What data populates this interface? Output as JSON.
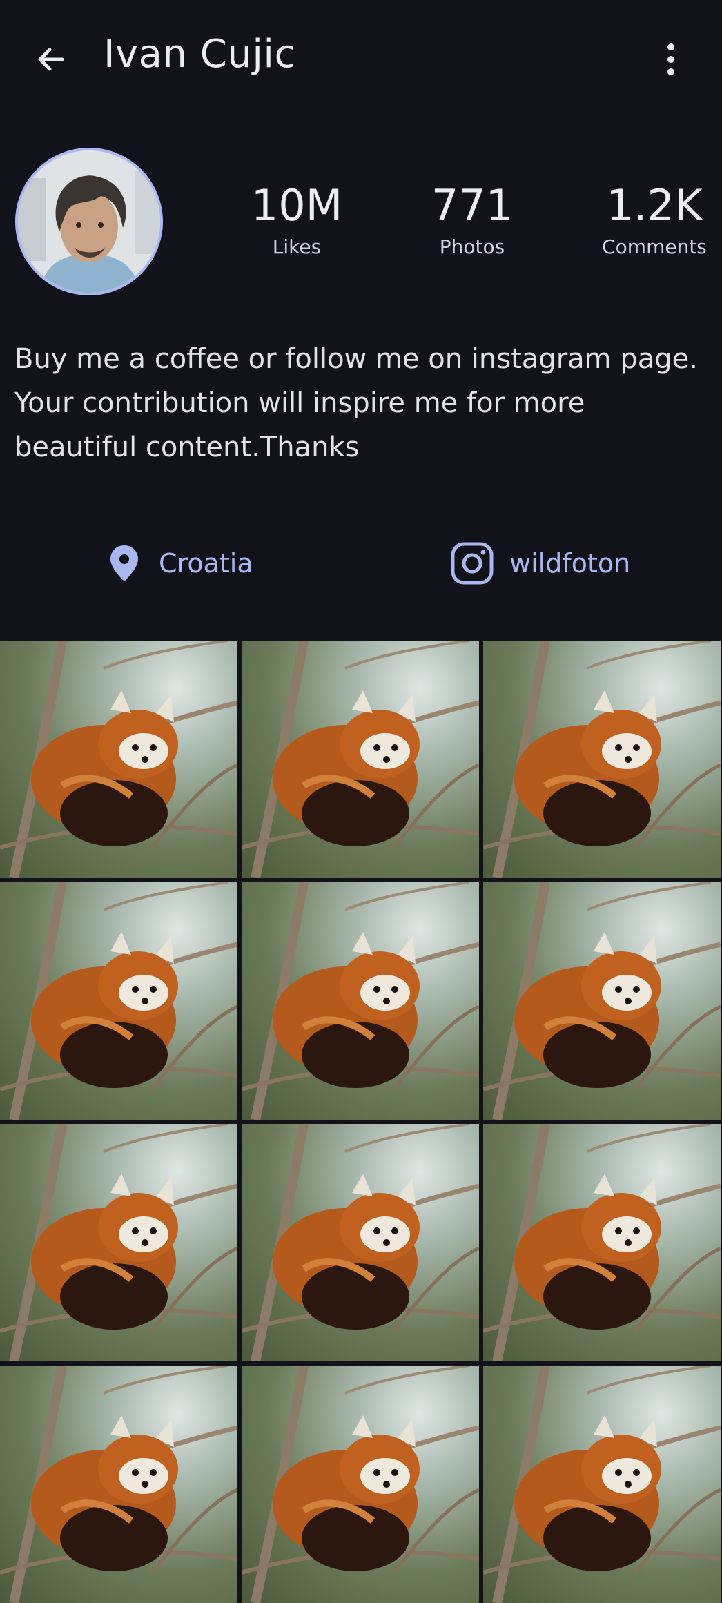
{
  "header": {
    "title": "Ivan Cujic",
    "back_icon": "arrow-left-icon",
    "more_icon": "more-vertical-icon"
  },
  "profile": {
    "avatar_icon": "avatar",
    "stats": [
      {
        "value": "10M",
        "label": "Likes"
      },
      {
        "value": "771",
        "label": "Photos"
      },
      {
        "value": "1.2K",
        "label": "Comments"
      }
    ],
    "bio_lines": [
      "Buy me a coffee or follow me on instagram page.",
      "Your contribution will inspire me for more",
      "beautiful content.Thanks"
    ],
    "location": {
      "icon": "map-pin-icon",
      "text": "Croatia"
    },
    "instagram": {
      "icon": "instagram-icon",
      "text": "wildfoton"
    }
  },
  "colors": {
    "background": "#12131a",
    "accent": "#aab8f2",
    "text": "#ececf3"
  },
  "gallery": {
    "items": [
      "red-panda-photo",
      "red-panda-photo",
      "red-panda-photo",
      "red-panda-photo",
      "red-panda-photo",
      "red-panda-photo",
      "red-panda-photo",
      "red-panda-photo",
      "red-panda-photo",
      "red-panda-photo",
      "red-panda-photo",
      "red-panda-photo"
    ]
  }
}
